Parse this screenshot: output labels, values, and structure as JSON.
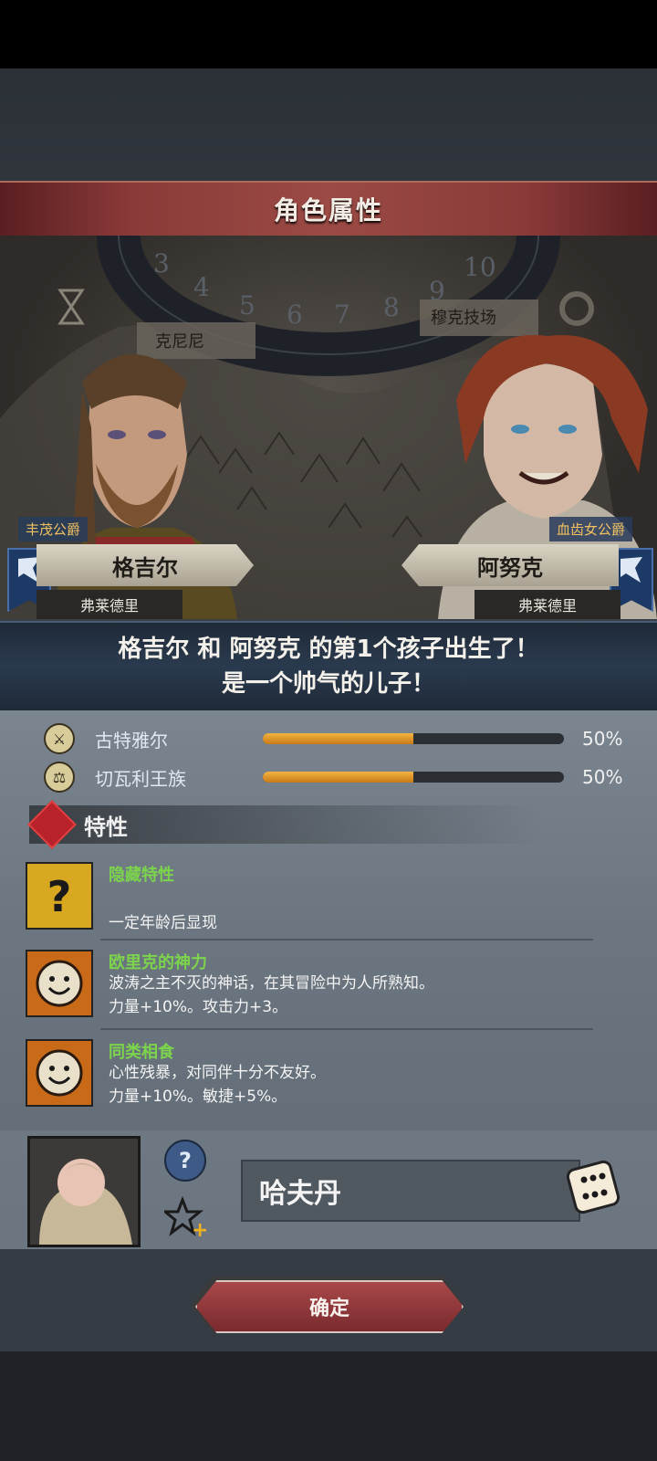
{
  "header": {
    "title": "角色属性"
  },
  "scene": {
    "map_labels": [
      "克尼尼",
      "穆克技场"
    ],
    "dial_numbers": [
      "3",
      "4",
      "5",
      "6",
      "7",
      "8",
      "9",
      "10"
    ]
  },
  "father": {
    "rank": "丰茂公爵",
    "name": "格吉尔",
    "house": "弗莱德里"
  },
  "mother": {
    "rank": "血齿女公爵",
    "name": "阿努克",
    "house": "弗莱德里"
  },
  "birth": {
    "line1": "格吉尔 和 阿努克 的第1个孩子出生了！",
    "line2": "是一个帅气的儿子！"
  },
  "lineage": [
    {
      "name": "古特雅尔",
      "percent": 50,
      "percent_label": "50%"
    },
    {
      "name": "切瓦利王族",
      "percent": 50,
      "percent_label": "50%"
    }
  ],
  "traits_section": {
    "title": "特性"
  },
  "traits": [
    {
      "icon": "question-mark-icon",
      "name": "隐藏特性",
      "desc1": "",
      "desc2": "一定年龄后显现"
    },
    {
      "icon": "smiling-sun-icon",
      "name": "欧里克的神力",
      "desc1": "波涛之主不灭的神话，在其冒险中为人所熟知。",
      "desc2": "力量+10%。攻击力+3。"
    },
    {
      "icon": "smiling-sun-icon",
      "name": "同类相食",
      "desc1": "心性残暴，对同伴十分不友好。",
      "desc2": "力量+10%。敏捷+5%。"
    }
  ],
  "child": {
    "name": "哈夫丹",
    "help_label": "?"
  },
  "confirm_label": "确定",
  "colors": {
    "accent": "#9b4a44",
    "trait_green": "#7cd44c",
    "bar_fill": "#f2b440"
  }
}
